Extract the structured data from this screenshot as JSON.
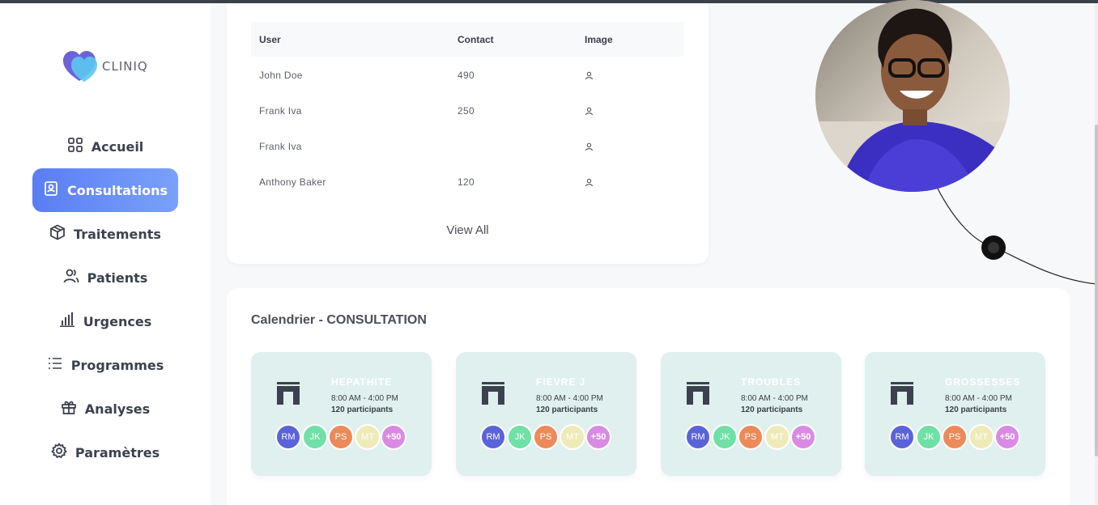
{
  "brand": {
    "name": "CLINIQ"
  },
  "sidebar": {
    "items": [
      {
        "label": "Accueil",
        "icon": "grid-icon",
        "active": false
      },
      {
        "label": "Consultations",
        "icon": "id-card-icon",
        "active": true
      },
      {
        "label": "Traitements",
        "icon": "box-icon",
        "active": false
      },
      {
        "label": "Patients",
        "icon": "users-icon",
        "active": false
      },
      {
        "label": "Urgences",
        "icon": "bar-chart-icon",
        "active": false
      },
      {
        "label": "Programmes",
        "icon": "list-icon",
        "active": false
      },
      {
        "label": "Analyses",
        "icon": "gift-icon",
        "active": false
      },
      {
        "label": "Paramètres",
        "icon": "gear-icon",
        "active": false
      }
    ]
  },
  "table": {
    "headers": [
      "User",
      "Contact",
      "Image"
    ],
    "rows": [
      {
        "user": "John Doe",
        "contact": "490"
      },
      {
        "user": "Frank Iva",
        "contact": "250"
      },
      {
        "user": "Frank Iva",
        "contact": ""
      },
      {
        "user": "Anthony Baker",
        "contact": "120"
      }
    ],
    "view_all": "View All"
  },
  "calendar": {
    "title": "Calendrier - CONSULTATION",
    "events": [
      {
        "name": "HEPATHITE",
        "time": "8:00 AM - 4:00 PM",
        "participants": "120 participants"
      },
      {
        "name": "FIEVRE J",
        "time": "8:00 AM - 4:00 PM",
        "participants": "120 participants"
      },
      {
        "name": "TROUBLES",
        "time": "8:00 AM - 4:00 PM",
        "participants": "120 participants"
      },
      {
        "name": "GROSSESSES",
        "time": "8:00 AM - 4:00 PM",
        "participants": "120 participants"
      }
    ],
    "chips": [
      {
        "label": "RM",
        "color": "#5b63d9"
      },
      {
        "label": "JK",
        "color": "#6fe0a6"
      },
      {
        "label": "PS",
        "color": "#ec8a5a"
      },
      {
        "label": "MT",
        "color": "#efebb8"
      },
      {
        "label": "+50",
        "color": "#d98be3"
      }
    ]
  },
  "colors": {
    "accent": "#5a7df3",
    "event_bg": "#dff0ee",
    "sidebar_bg": "#ffffff"
  }
}
